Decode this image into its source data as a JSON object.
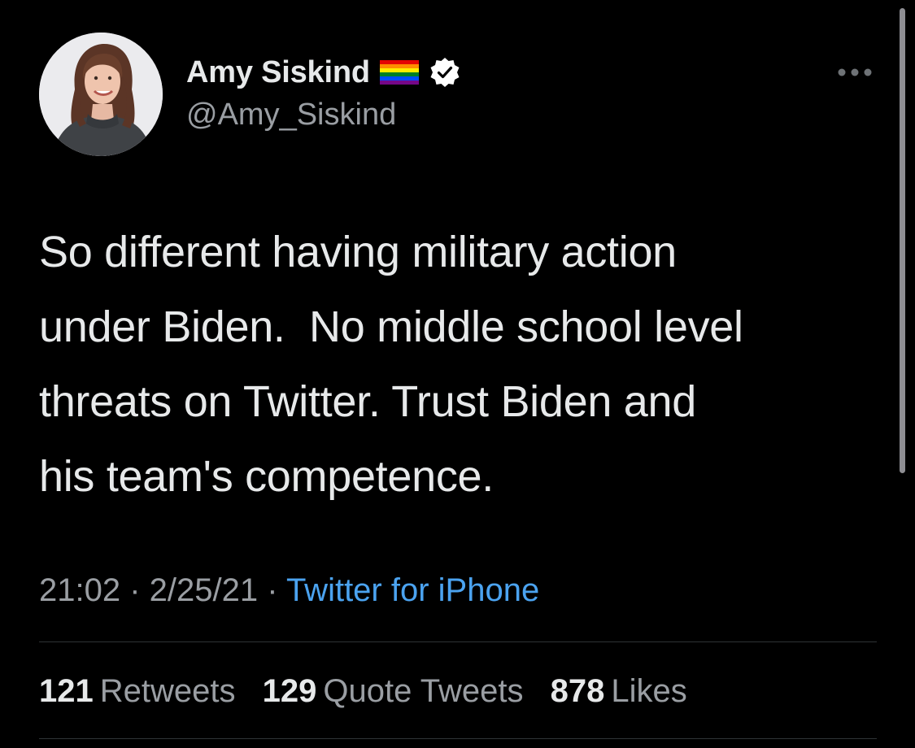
{
  "author": {
    "display_name": "Amy Siskind",
    "handle": "@Amy_Siskind",
    "badges": [
      "rainbow-flag-icon",
      "verified-icon"
    ]
  },
  "tweet": {
    "text": "So different having military action\nunder Biden.  No middle school level\nthreats on Twitter. Trust Biden and\nhis team's competence.",
    "time": "21:02",
    "separator_1": " · ",
    "date": "2/25/21",
    "separator_2": " · ",
    "source": "Twitter for iPhone"
  },
  "stats": {
    "retweets_count": "121",
    "retweets_label": "Retweets",
    "quotes_count": "129",
    "quotes_label": "Quote Tweets",
    "likes_count": "878",
    "likes_label": "Likes"
  },
  "icons": {
    "more": "more-horizontal-icon",
    "verified": "verified-icon",
    "flag": "rainbow-flag-icon"
  },
  "colors": {
    "background": "#000000",
    "primary_text": "#e7e9ea",
    "secondary_text": "#9a9ea3",
    "link": "#4ba3f0",
    "divider": "#2f3336"
  }
}
